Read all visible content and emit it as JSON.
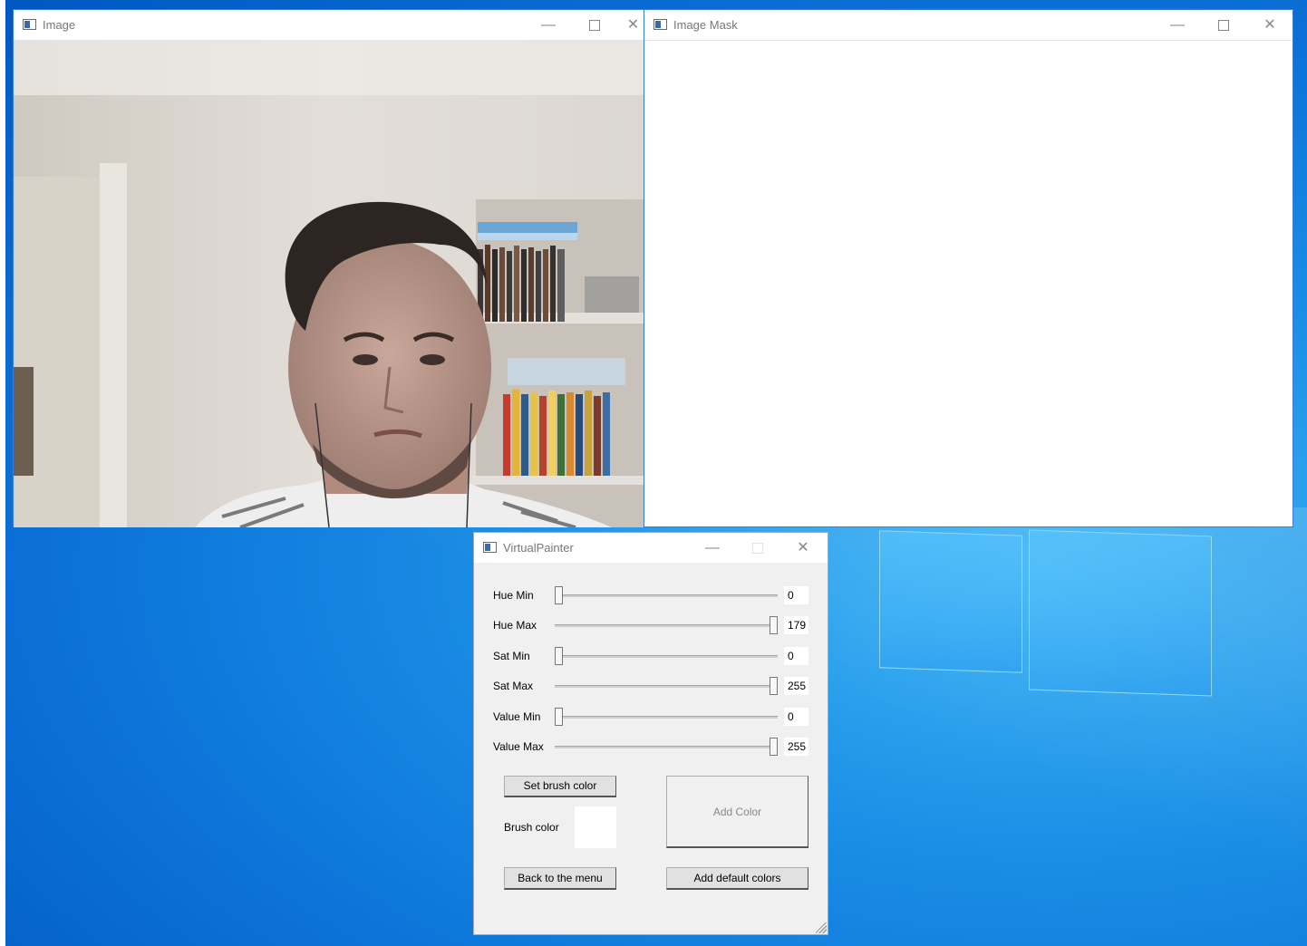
{
  "windows": {
    "image": {
      "title": "Image"
    },
    "mask": {
      "title": "Image Mask"
    },
    "painter": {
      "title": "VirtualPainter"
    }
  },
  "controls": {
    "minimize": "—",
    "close": "✕"
  },
  "webcam": {
    "description_icon": "webcam-frame"
  },
  "sliders": [
    {
      "label": "Hue Min",
      "value": "0",
      "fraction": 0.0
    },
    {
      "label": "Hue Max",
      "value": "179",
      "fraction": 1.0
    },
    {
      "label": "Sat Min",
      "value": "0",
      "fraction": 0.0
    },
    {
      "label": "Sat Max",
      "value": "255",
      "fraction": 1.0
    },
    {
      "label": "Value Min",
      "value": "0",
      "fraction": 0.0
    },
    {
      "label": "Value Max",
      "value": "255",
      "fraction": 1.0
    }
  ],
  "buttons": {
    "set_brush_color": "Set brush color",
    "add_color": "Add Color",
    "back_to_menu": "Back to the menu",
    "add_default_colors": "Add default colors"
  },
  "brush": {
    "label": "Brush color",
    "color": "#ffffff"
  },
  "colors": {
    "desktop_accent": "#0a6fd6",
    "window_border": "#3a7bd5"
  }
}
